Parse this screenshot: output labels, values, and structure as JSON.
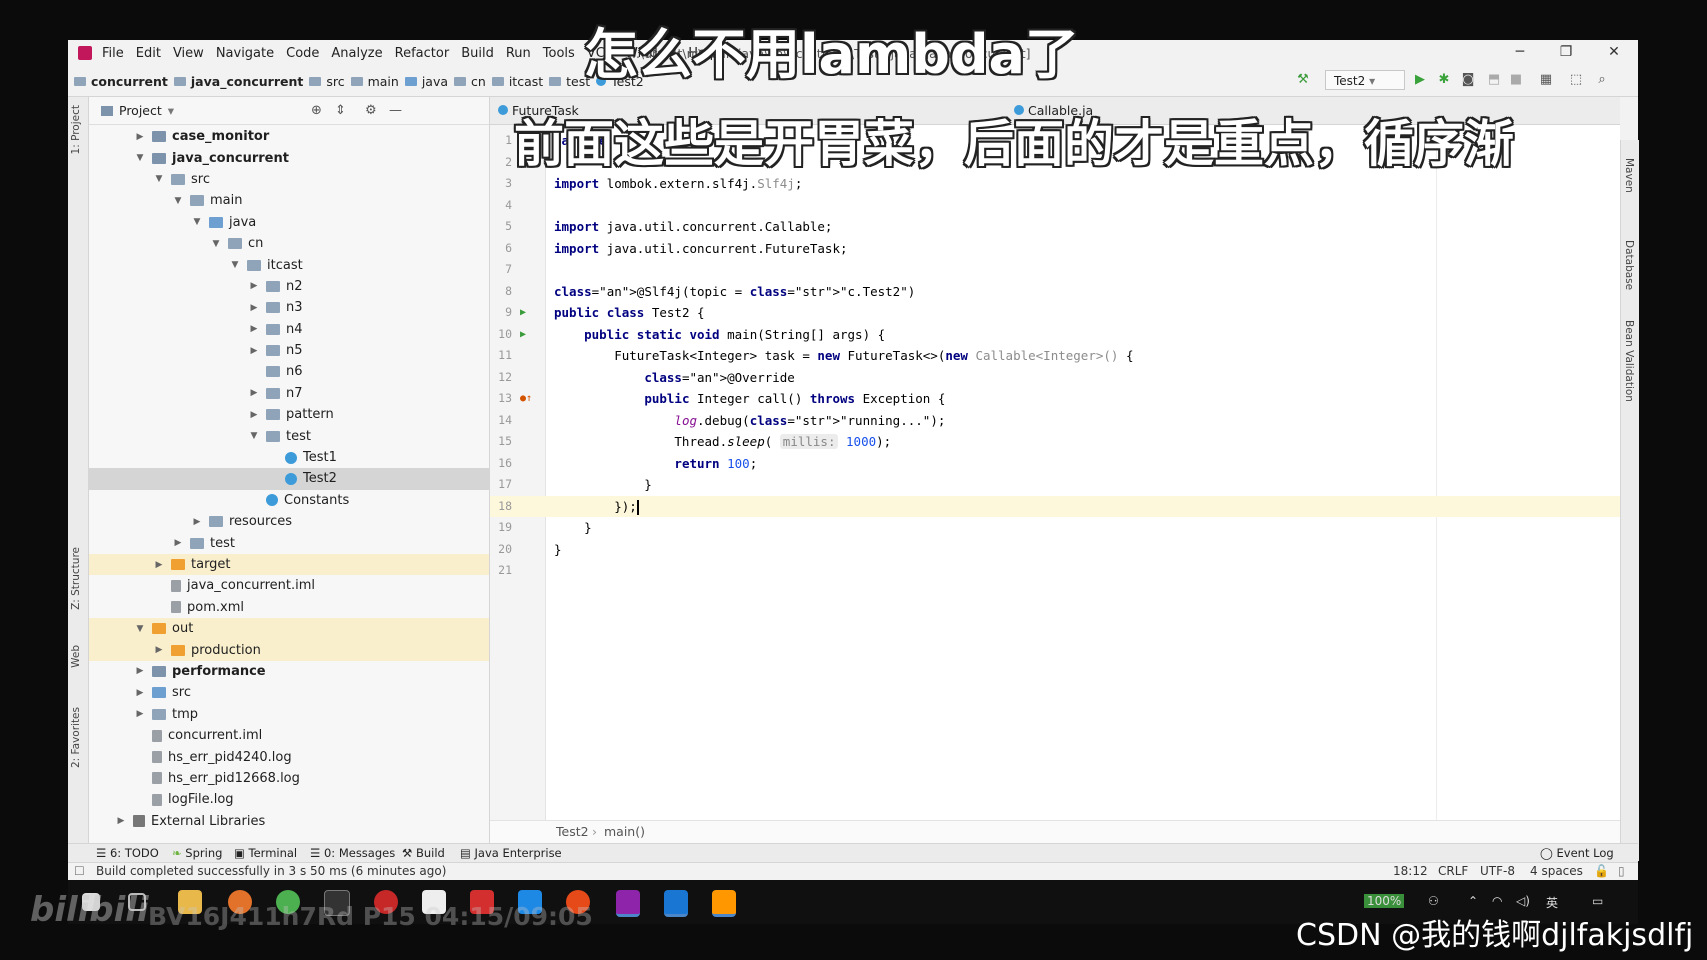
{
  "window": {
    "menu": [
      "File",
      "Edit",
      "View",
      "Navigate",
      "Code",
      "Analyze",
      "Refactor",
      "Build",
      "Run",
      "Tools",
      "VCS",
      "Window",
      "Help"
    ],
    "title": "...\\urrent\\rc\\main\\java\\cn\\itcast\\test\\Test2.java [java_concurrent]"
  },
  "breadcrumbs": [
    "concurrent",
    "java_concurrent",
    "src",
    "main",
    "java",
    "cn",
    "itcast",
    "test",
    "Test2"
  ],
  "run_config": "Test2",
  "project_panel": {
    "title": "Project",
    "tree": [
      {
        "label": "case_monitor",
        "depth": 0,
        "arrow": "right",
        "icon": "mod",
        "bold": true
      },
      {
        "label": "java_concurrent",
        "depth": 0,
        "arrow": "down",
        "icon": "mod",
        "bold": true
      },
      {
        "label": "src",
        "depth": 1,
        "arrow": "down",
        "icon": "folder"
      },
      {
        "label": "main",
        "depth": 2,
        "arrow": "down",
        "icon": "folder"
      },
      {
        "label": "java",
        "depth": 3,
        "arrow": "down",
        "icon": "src"
      },
      {
        "label": "cn",
        "depth": 4,
        "arrow": "down",
        "icon": "folder"
      },
      {
        "label": "itcast",
        "depth": 5,
        "arrow": "down",
        "icon": "folder"
      },
      {
        "label": "n2",
        "depth": 6,
        "arrow": "right",
        "icon": "folder"
      },
      {
        "label": "n3",
        "depth": 6,
        "arrow": "right",
        "icon": "folder"
      },
      {
        "label": "n4",
        "depth": 6,
        "arrow": "right",
        "icon": "folder"
      },
      {
        "label": "n5",
        "depth": 6,
        "arrow": "right",
        "icon": "folder"
      },
      {
        "label": "n6",
        "depth": 6,
        "arrow": "",
        "icon": "folder"
      },
      {
        "label": "n7",
        "depth": 6,
        "arrow": "right",
        "icon": "folder"
      },
      {
        "label": "pattern",
        "depth": 6,
        "arrow": "right",
        "icon": "folder"
      },
      {
        "label": "test",
        "depth": 6,
        "arrow": "down",
        "icon": "folder"
      },
      {
        "label": "Test1",
        "depth": 7,
        "arrow": "",
        "icon": "class"
      },
      {
        "label": "Test2",
        "depth": 7,
        "arrow": "",
        "icon": "class",
        "selected": true
      },
      {
        "label": "Constants",
        "depth": 6,
        "arrow": "",
        "icon": "class"
      },
      {
        "label": "resources",
        "depth": 3,
        "arrow": "right",
        "icon": "folder"
      },
      {
        "label": "test",
        "depth": 2,
        "arrow": "right",
        "icon": "folder"
      },
      {
        "label": "target",
        "depth": 1,
        "arrow": "right",
        "icon": "orange",
        "highlight": true
      },
      {
        "label": "java_concurrent.iml",
        "depth": 1,
        "arrow": "",
        "icon": "file"
      },
      {
        "label": "pom.xml",
        "depth": 1,
        "arrow": "",
        "icon": "file"
      },
      {
        "label": "out",
        "depth": 0,
        "arrow": "down",
        "icon": "orange",
        "highlight": true
      },
      {
        "label": "production",
        "depth": 1,
        "arrow": "right",
        "icon": "orange",
        "highlight": true
      },
      {
        "label": "performance",
        "depth": 0,
        "arrow": "right",
        "icon": "mod",
        "bold": true
      },
      {
        "label": "src",
        "depth": 0,
        "arrow": "right",
        "icon": "src"
      },
      {
        "label": "tmp",
        "depth": 0,
        "arrow": "right",
        "icon": "folder"
      },
      {
        "label": "concurrent.iml",
        "depth": 0,
        "arrow": "",
        "icon": "file"
      },
      {
        "label": "hs_err_pid4240.log",
        "depth": 0,
        "arrow": "",
        "icon": "file"
      },
      {
        "label": "hs_err_pid12668.log",
        "depth": 0,
        "arrow": "",
        "icon": "file"
      },
      {
        "label": "logFile.log",
        "depth": 0,
        "arrow": "",
        "icon": "file"
      },
      {
        "label": "External Libraries",
        "depth": -1,
        "arrow": "right",
        "icon": "lib"
      }
    ]
  },
  "tabs": [
    "FutureTask",
    "Callable.ja"
  ],
  "editor": {
    "lines": [
      "package",
      "",
      "import lombok.extern.slf4j.Slf4j;",
      "",
      "import java.util.concurrent.Callable;",
      "import java.util.concurrent.FutureTask;",
      "",
      "@Slf4j(topic = \"c.Test2\")",
      "public class Test2 {",
      "    public static void main(String[] args) {",
      "        FutureTask<Integer> task = new FutureTask<>(new Callable<Integer>() {",
      "            @Override",
      "            public Integer call() throws Exception {",
      "                log.debug(\"running...\");",
      "                Thread.sleep( millis: 1000);",
      "                return 100;",
      "            }",
      "        });",
      "    }",
      "}",
      ""
    ],
    "current_line": 18,
    "breadcrumb": [
      "Test2",
      "main()"
    ]
  },
  "tool_windows": [
    "6: TODO",
    "Spring",
    "Terminal",
    "0: Messages",
    "Build",
    "Java Enterprise",
    "Event Log"
  ],
  "left_stripe": [
    "1: Project",
    "Z: Structure",
    "Web",
    "2: Favorites"
  ],
  "right_stripe": [
    "Maven",
    "Database",
    "Bean Validation"
  ],
  "status": {
    "message": "Build completed successfully in 3 s 50 ms (6 minutes ago)",
    "position": "18:12",
    "line_sep": "CRLF",
    "encoding": "UTF-8",
    "indent": "4 spaces"
  },
  "overlay": {
    "subtitle_top": "怎么不用lambda了",
    "subtitle_main": "前面这些是开胃菜，后面的才是重点，循序渐",
    "bili_logo": "bilibili",
    "bv_text": "BV16J411h7Rd P15 04:15/09:05",
    "csdn_watermark": "CSDN @我的钱啊djlfakjsdlfj"
  },
  "taskbar": {
    "battery": "100%",
    "ime": "英"
  }
}
